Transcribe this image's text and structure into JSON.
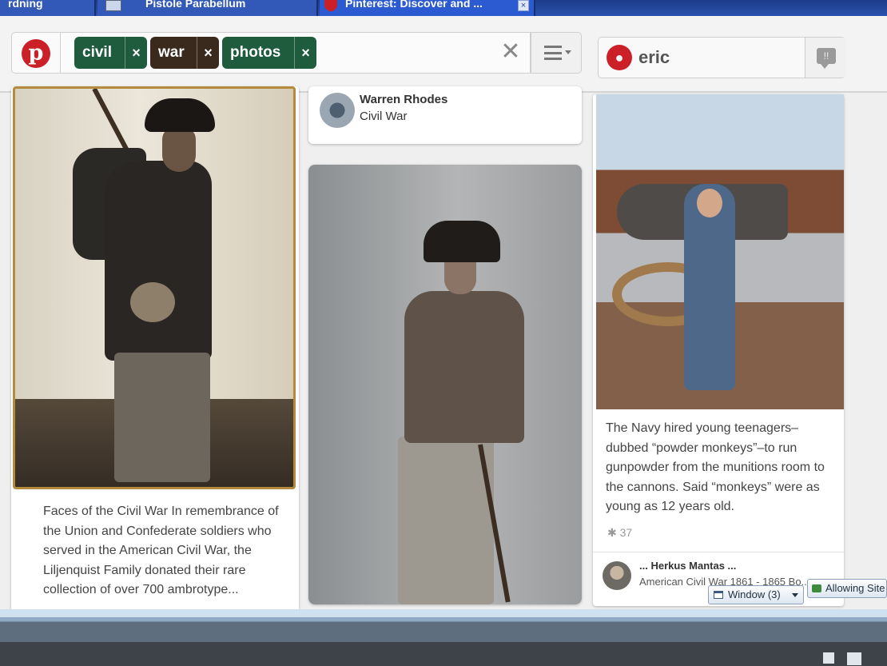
{
  "browser": {
    "tabs": [
      {
        "label": "rdning"
      },
      {
        "label": "Pistole Parabellum"
      },
      {
        "label": "Pinterest: Discover and ..."
      }
    ],
    "close_glyph": "×"
  },
  "header": {
    "logo_glyph": "p",
    "search": {
      "chips": [
        {
          "label": "civil",
          "remove": "×"
        },
        {
          "label": "war",
          "remove": "×"
        },
        {
          "label": "photos",
          "remove": "×"
        }
      ],
      "clear_glyph": "✕"
    },
    "user": {
      "name": "eric",
      "pin_glyph": "📍"
    },
    "notifications_glyph": "!!"
  },
  "pins": {
    "col1": {
      "description": "Faces of the Civil War In remembrance of the Union and Confederate soldiers who served in the American Civil War, the Liljenquist Family donated their rare collection of over 700 ambrotype..."
    },
    "col2_header": {
      "user": "Warren Rhodes",
      "board": "Civil War"
    },
    "col3": {
      "description": "The Navy hired young teenagers–dubbed “powder monkeys”–to run gunpowder from the munitions room to the cannons. Said “monkeys” were as young as 12 years old.",
      "repin_count": "37",
      "user": "... Herkus Mantas ...",
      "board": "American Civil War 1861 - 1865 Bo..."
    }
  },
  "popups": {
    "window_label": "Window (3)",
    "allow_label": "Allowing Site"
  },
  "colors": {
    "pinterest_red": "#cb2027",
    "chip_green": "#1f5c3e",
    "chip_brown": "#3a2a1e"
  },
  "icons": [
    "pinterest-logo-icon",
    "menu-icon",
    "notification-icon",
    "window-icon",
    "allow-icon"
  ]
}
